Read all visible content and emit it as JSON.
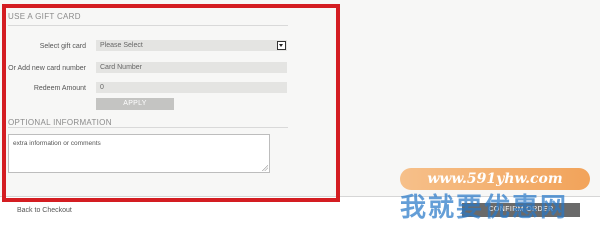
{
  "gift_card": {
    "header": "USE A GIFT CARD",
    "select_label": "Select gift card",
    "select_value": "Please Select",
    "card_number_label": "Or Add new card number",
    "card_number_placeholder": "Card Number",
    "redeem_label": "Redeem Amount",
    "redeem_value": "0",
    "apply_label": "APPLY"
  },
  "optional": {
    "header": "OPTIONAL INFORMATION",
    "textarea_value": "extra information or comments"
  },
  "footer": {
    "back_link": "Back to Checkout",
    "confirm_label": "CONFIRM ORDER"
  },
  "watermark": {
    "url": "www.591yhw.com",
    "text": "我就要优惠网"
  },
  "colors": {
    "highlight_border": "#d41d22",
    "field_bg": "#e4e4e2",
    "button_bg": "#c4c4c2"
  }
}
